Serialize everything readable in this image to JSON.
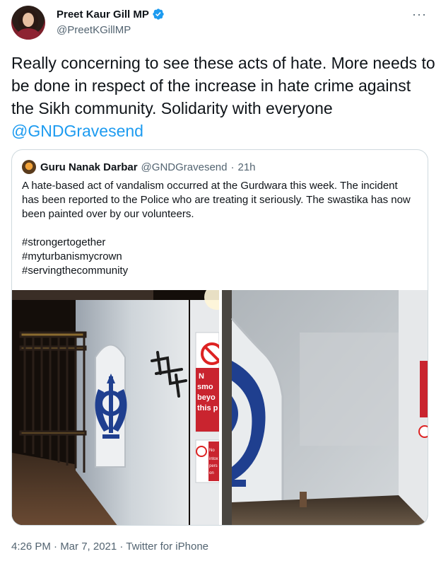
{
  "author": {
    "display_name": "Preet Kaur Gill MP",
    "handle": "@PreetKGillMP",
    "verified": true,
    "avatar_icon": "profile-photo"
  },
  "more_label": "···",
  "tweet": {
    "text": "Really concerning to see these acts of hate. More needs to be done in respect of the increase in hate crime against the Sikh community. Solidarity with everyone",
    "mention": "@GNDGravesend"
  },
  "quoted_tweet": {
    "display_name": "Guru Nanak Darbar",
    "handle": "@GNDGravesend",
    "separator": "·",
    "time": "21h",
    "text": "A hate-based act of vandalism occurred at the Gurdwara this week. The incident has been reported to the Police who are treating it seriously. The swastika has now been painted over by our volunteers.",
    "hashtags": [
      "#strongertogether",
      "#myturbanismycrown",
      "#servingthecommunity"
    ],
    "photos": [
      {
        "sign_lines": [
          "N",
          "smo",
          "beyo",
          "this p"
        ],
        "sign_lower": [
          "No",
          "intox",
          "pers",
          "on"
        ]
      },
      {
        "sign_lines": []
      }
    ]
  },
  "footer": {
    "timestamp": "4:26 PM · Mar 7, 2021 · Twitter for iPhone"
  },
  "colors": {
    "link": "#1d9bf0",
    "secondary_text": "#536471",
    "border": "#cfd9de",
    "khanda_blue": "#1f3f8f"
  }
}
